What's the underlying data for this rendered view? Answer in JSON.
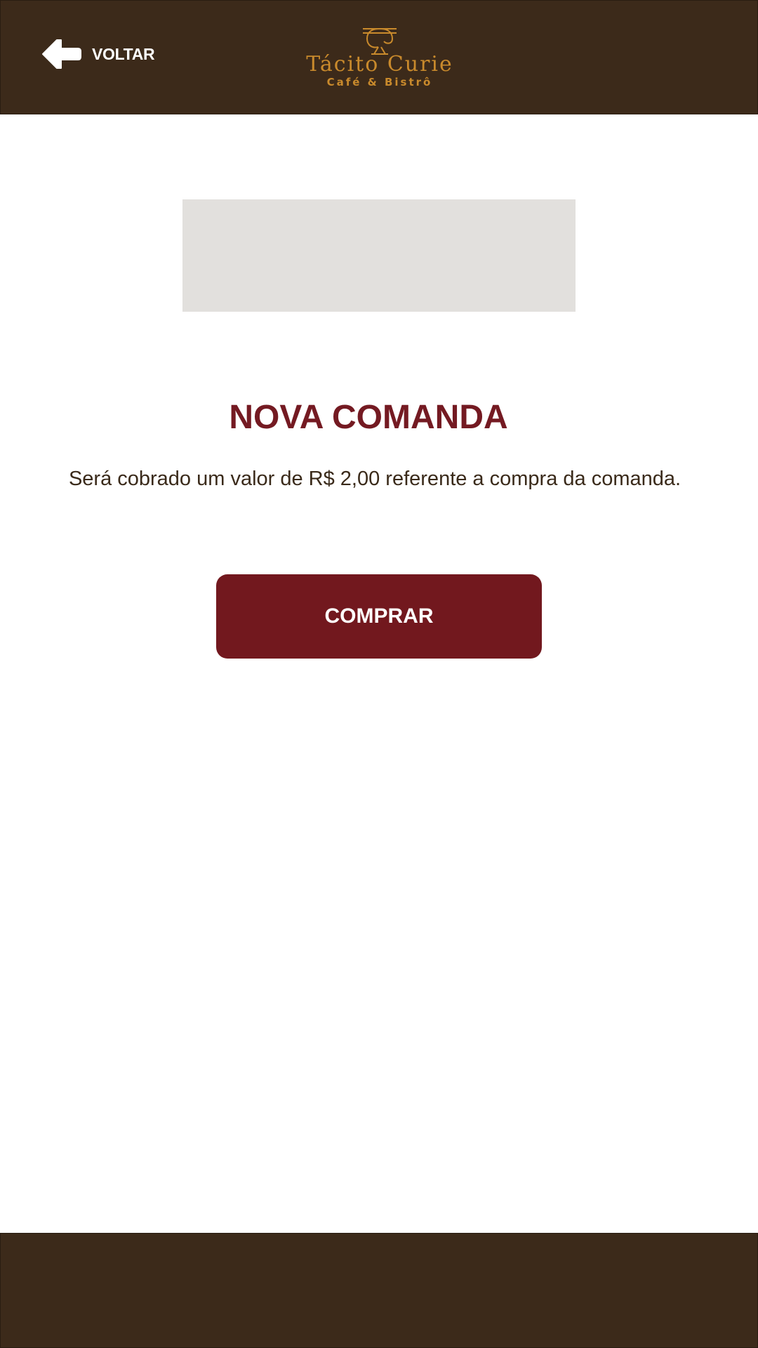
{
  "header": {
    "back_label": "VOLTAR",
    "brand_name": "Tácito Curie",
    "brand_tagline": "Café & Bistrô"
  },
  "main": {
    "title": "NOVA COMANDA",
    "description": "Será cobrado um valor de R$ 2,00 referente a compra da comanda.",
    "buy_label": "COMPRAR"
  },
  "colors": {
    "header_bg": "#3c2a1a",
    "brand_gold": "#c98a2c",
    "title_red": "#741a22",
    "button_red": "#72181e",
    "placeholder_gray": "#e2e0dd"
  },
  "icons": {
    "back": "arrow-left-icon",
    "brand": "tc-monogram-icon"
  }
}
